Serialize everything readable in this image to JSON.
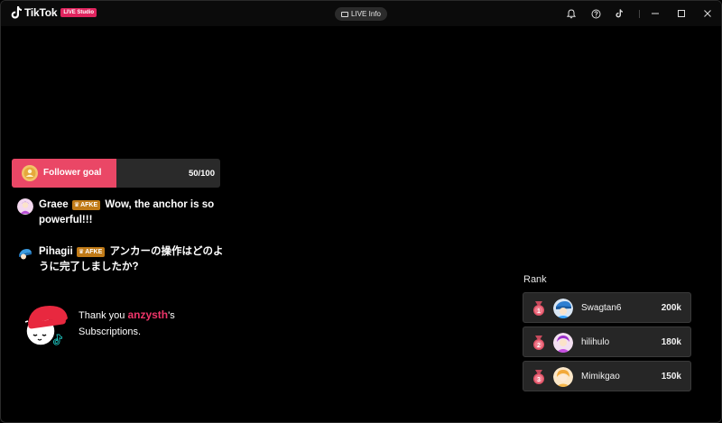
{
  "app": {
    "brand_name": "TikTok",
    "brand_badge": "LIVE Studio"
  },
  "toolbar": {
    "live_info_label": "LIVE Info",
    "icons": [
      "bell-icon",
      "help-icon",
      "tiktok-icon",
      "minimize-icon",
      "maximize-icon",
      "close-icon"
    ]
  },
  "follower_goal": {
    "label": "Follower goal",
    "count_text": "50/100",
    "progress": 0.5,
    "fill_color": "#ea4766"
  },
  "comments": [
    {
      "user": "Graee",
      "badge": "AFKE",
      "message": "Wow, the anchor is so powerful!!!"
    },
    {
      "user": "Pihagii",
      "badge": "AFKE",
      "message": "アンカーの操作はどのように完了しましたか?"
    }
  ],
  "thanks": {
    "prefix": "Thank you",
    "username": "anzysth",
    "suffix": "'s",
    "line2": "Subscriptions."
  },
  "rank": {
    "title": "Rank",
    "rows": [
      {
        "place": "1",
        "name": "Swagtan6",
        "score": "200k"
      },
      {
        "place": "2",
        "name": "hilihulo",
        "score": "180k"
      },
      {
        "place": "3",
        "name": "Mimikgao",
        "score": "150k"
      }
    ]
  },
  "colors": {
    "accent": "#ea4766",
    "username_highlight": "#f0356a",
    "badge": "#c07a17",
    "background": "#000000"
  }
}
